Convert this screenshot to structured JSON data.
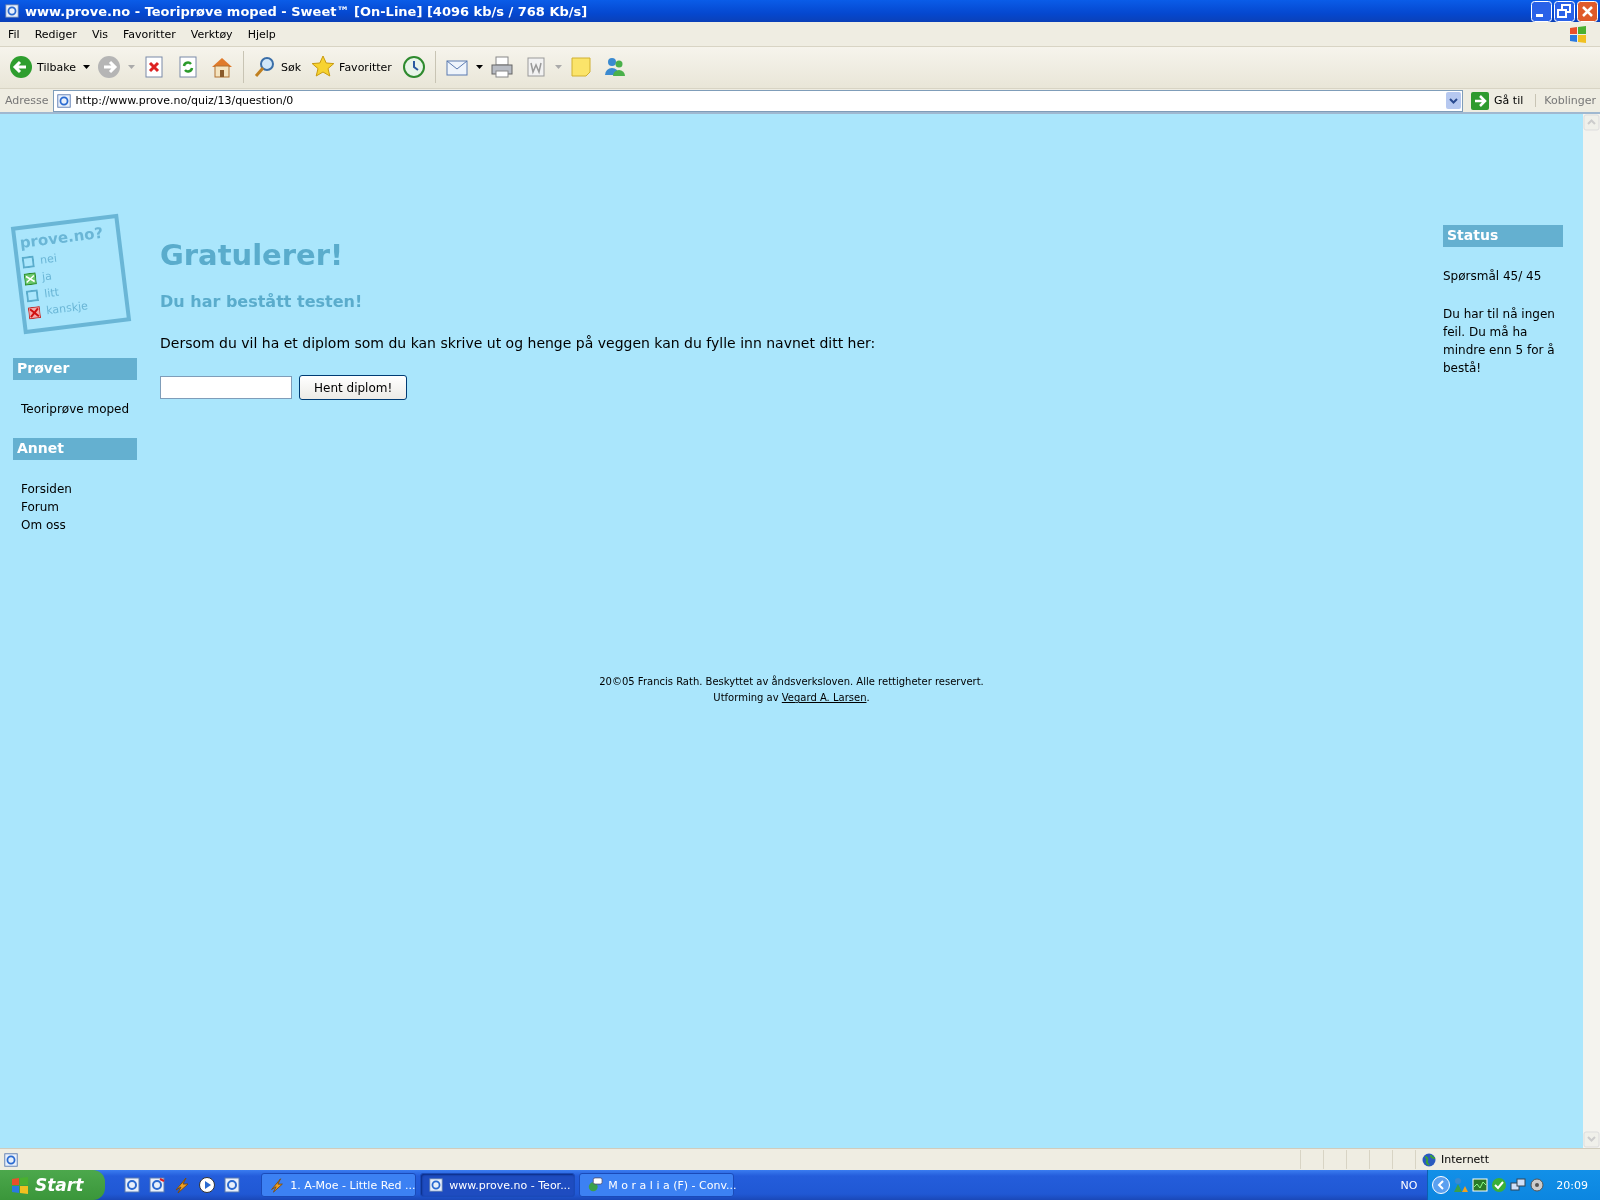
{
  "window": {
    "title": "www.prove.no - Teoriprøve moped - Sweet™ [On-Line] [4096 kb/s / 768 Kb/s]"
  },
  "menu": [
    "Fil",
    "Rediger",
    "Vis",
    "Favoritter",
    "Verktøy",
    "Hjelp"
  ],
  "toolbar": [
    {
      "kind": "back",
      "label": "Tilbake",
      "dropdown": true
    },
    {
      "kind": "forward",
      "dropdown": true
    },
    {
      "kind": "stop"
    },
    {
      "kind": "refresh"
    },
    {
      "kind": "home"
    },
    {
      "kind": "search",
      "label": "Søk"
    },
    {
      "kind": "favorites",
      "label": "Favoritter"
    },
    {
      "kind": "history"
    },
    {
      "kind": "mail",
      "dropdown": true
    },
    {
      "kind": "print"
    },
    {
      "kind": "edit",
      "dropdown": true
    },
    {
      "kind": "note"
    },
    {
      "kind": "messenger"
    }
  ],
  "address": {
    "label": "Adresse",
    "url": "http://www.prove.no/quiz/13/question/0",
    "go": "Gå til",
    "links": "Koblinger"
  },
  "logo": {
    "title": "prove.no?",
    "options": [
      {
        "label": "nei",
        "kind": "empty"
      },
      {
        "label": "ja",
        "kind": "check"
      },
      {
        "label": "litt",
        "kind": "empty"
      },
      {
        "label": "kanskje",
        "kind": "cross"
      }
    ]
  },
  "sidebar": [
    {
      "heading": "Prøver",
      "items": [
        "Teoriprøve moped"
      ]
    },
    {
      "heading": "Annet",
      "items": [
        "Forsiden",
        "Forum",
        "Om oss"
      ]
    }
  ],
  "main": {
    "heading": "Gratulerer!",
    "subheading": "Du har bestått testen!",
    "instruction": "Dersom du vil ha et diplom som du kan skrive ut og henge på veggen kan du fylle inn navnet ditt her:",
    "button": "Hent diplom!"
  },
  "status": {
    "heading": "Status",
    "progress": "Spørsmål 45/ 45",
    "message": "Du har til nå ingen feil. Du må ha mindre enn 5 for å bestå!"
  },
  "footer": {
    "copyright": "20©05 Francis Rath. Beskyttet av åndsverksloven. Alle rettigheter reservert.",
    "credit_prefix": "Utforming av ",
    "credit_link": "Vegard A. Larsen",
    "credit_suffix": "."
  },
  "status_bar": {
    "zone": "Internett"
  },
  "taskbar": {
    "start": "Start",
    "quick_launch": [
      {
        "kind": "ie"
      },
      {
        "kind": "ie2"
      },
      {
        "kind": "winamp"
      },
      {
        "kind": "media"
      },
      {
        "kind": "ie"
      }
    ],
    "tasks": [
      {
        "label": "1. A-Moe - Little Red ...",
        "kind": "winamp",
        "selected": false
      },
      {
        "label": "www.prove.no - Teor...",
        "kind": "ie",
        "selected": true
      },
      {
        "label": "M o r a l i a (F) - Conv...",
        "kind": "chat",
        "selected": false
      }
    ],
    "language": "NO",
    "clock": "20:09"
  }
}
